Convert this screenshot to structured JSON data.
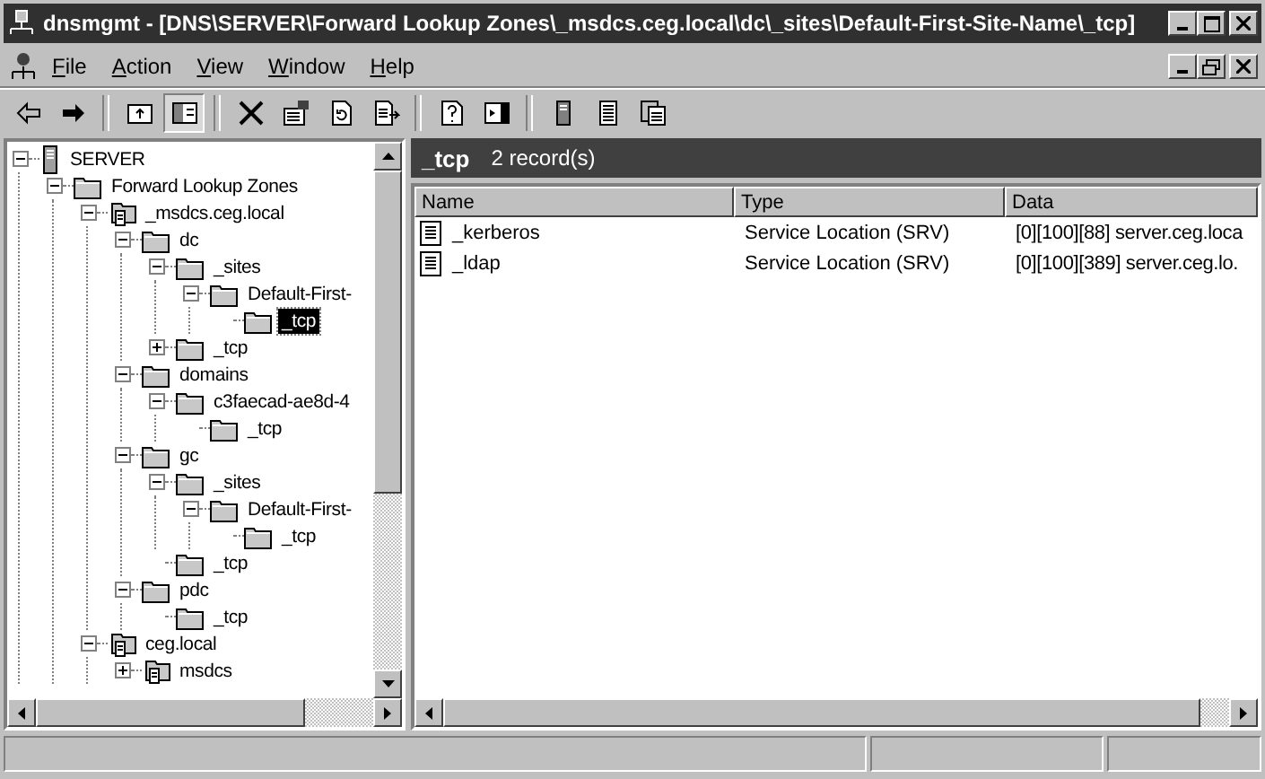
{
  "window": {
    "title": "dnsmgmt - [DNS\\SERVER\\Forward Lookup Zones\\_msdcs.ceg.local\\dc\\_sites\\Default-First-Site-Name\\_tcp]"
  },
  "menu": [
    "File",
    "Action",
    "View",
    "Window",
    "Help"
  ],
  "toolbar": [
    {
      "kind": "back",
      "pressed": false
    },
    {
      "kind": "forward",
      "pressed": false
    },
    {
      "kind": "separator"
    },
    {
      "kind": "up",
      "pressed": false
    },
    {
      "kind": "tree",
      "pressed": true
    },
    {
      "kind": "separator"
    },
    {
      "kind": "delete",
      "pressed": false
    },
    {
      "kind": "properties",
      "pressed": false
    },
    {
      "kind": "refresh",
      "pressed": false
    },
    {
      "kind": "export",
      "pressed": false
    },
    {
      "kind": "separator"
    },
    {
      "kind": "help",
      "pressed": false
    },
    {
      "kind": "pane",
      "pressed": false
    },
    {
      "kind": "separator"
    },
    {
      "kind": "server",
      "pressed": false
    },
    {
      "kind": "record",
      "pressed": false
    },
    {
      "kind": "records",
      "pressed": false
    }
  ],
  "tree": [
    {
      "label": "SERVER",
      "kind": "server",
      "expanded": true,
      "selected": false,
      "children": [
        {
          "label": "Forward Lookup Zones",
          "kind": "folder",
          "expanded": true,
          "selected": false,
          "children": [
            {
              "label": "_msdcs.ceg.local",
              "kind": "zone",
              "expanded": true,
              "selected": false,
              "children": [
                {
                  "label": "dc",
                  "kind": "folder",
                  "expanded": true,
                  "selected": false,
                  "children": [
                    {
                      "label": "_sites",
                      "kind": "folder",
                      "expanded": true,
                      "selected": false,
                      "children": [
                        {
                          "label": "Default-First-",
                          "kind": "folder",
                          "expanded": true,
                          "selected": false,
                          "children": [
                            {
                              "label": "_tcp",
                              "kind": "folder",
                              "selected": true
                            }
                          ]
                        }
                      ]
                    },
                    {
                      "label": "_tcp",
                      "kind": "folder",
                      "expanded": false,
                      "selected": false
                    }
                  ]
                },
                {
                  "label": "domains",
                  "kind": "folder",
                  "expanded": true,
                  "selected": false,
                  "children": [
                    {
                      "label": "c3faecad-ae8d-4",
                      "kind": "folder",
                      "expanded": true,
                      "selected": false,
                      "children": [
                        {
                          "label": "_tcp",
                          "kind": "folder",
                          "selected": false
                        }
                      ]
                    }
                  ]
                },
                {
                  "label": "gc",
                  "kind": "folder",
                  "expanded": true,
                  "selected": false,
                  "children": [
                    {
                      "label": "_sites",
                      "kind": "folder",
                      "expanded": true,
                      "selected": false,
                      "children": [
                        {
                          "label": "Default-First-",
                          "kind": "folder",
                          "expanded": true,
                          "selected": false,
                          "children": [
                            {
                              "label": "_tcp",
                              "kind": "folder",
                              "selected": false
                            }
                          ]
                        }
                      ]
                    },
                    {
                      "label": "_tcp",
                      "kind": "folder",
                      "selected": false
                    }
                  ]
                },
                {
                  "label": "pdc",
                  "kind": "folder",
                  "expanded": true,
                  "selected": false,
                  "children": [
                    {
                      "label": "_tcp",
                      "kind": "folder",
                      "selected": false
                    }
                  ]
                }
              ]
            },
            {
              "label": "ceg.local",
              "kind": "zone",
              "expanded": true,
              "selected": false,
              "children": [
                {
                  "label": "msdcs",
                  "kind": "zone",
                  "expanded": false,
                  "selected": false
                }
              ]
            }
          ]
        }
      ]
    }
  ],
  "details": {
    "heading": "_tcp",
    "count": "2 record(s)",
    "columns": [
      "Name",
      "Type",
      "Data"
    ],
    "rows": [
      {
        "name": "_kerberos",
        "type": "Service Location (SRV)",
        "data": "[0][100][88] server.ceg.loca"
      },
      {
        "name": "_ldap",
        "type": "Service Location (SRV)",
        "data": "[0][100][389] server.ceg.lo."
      }
    ]
  }
}
